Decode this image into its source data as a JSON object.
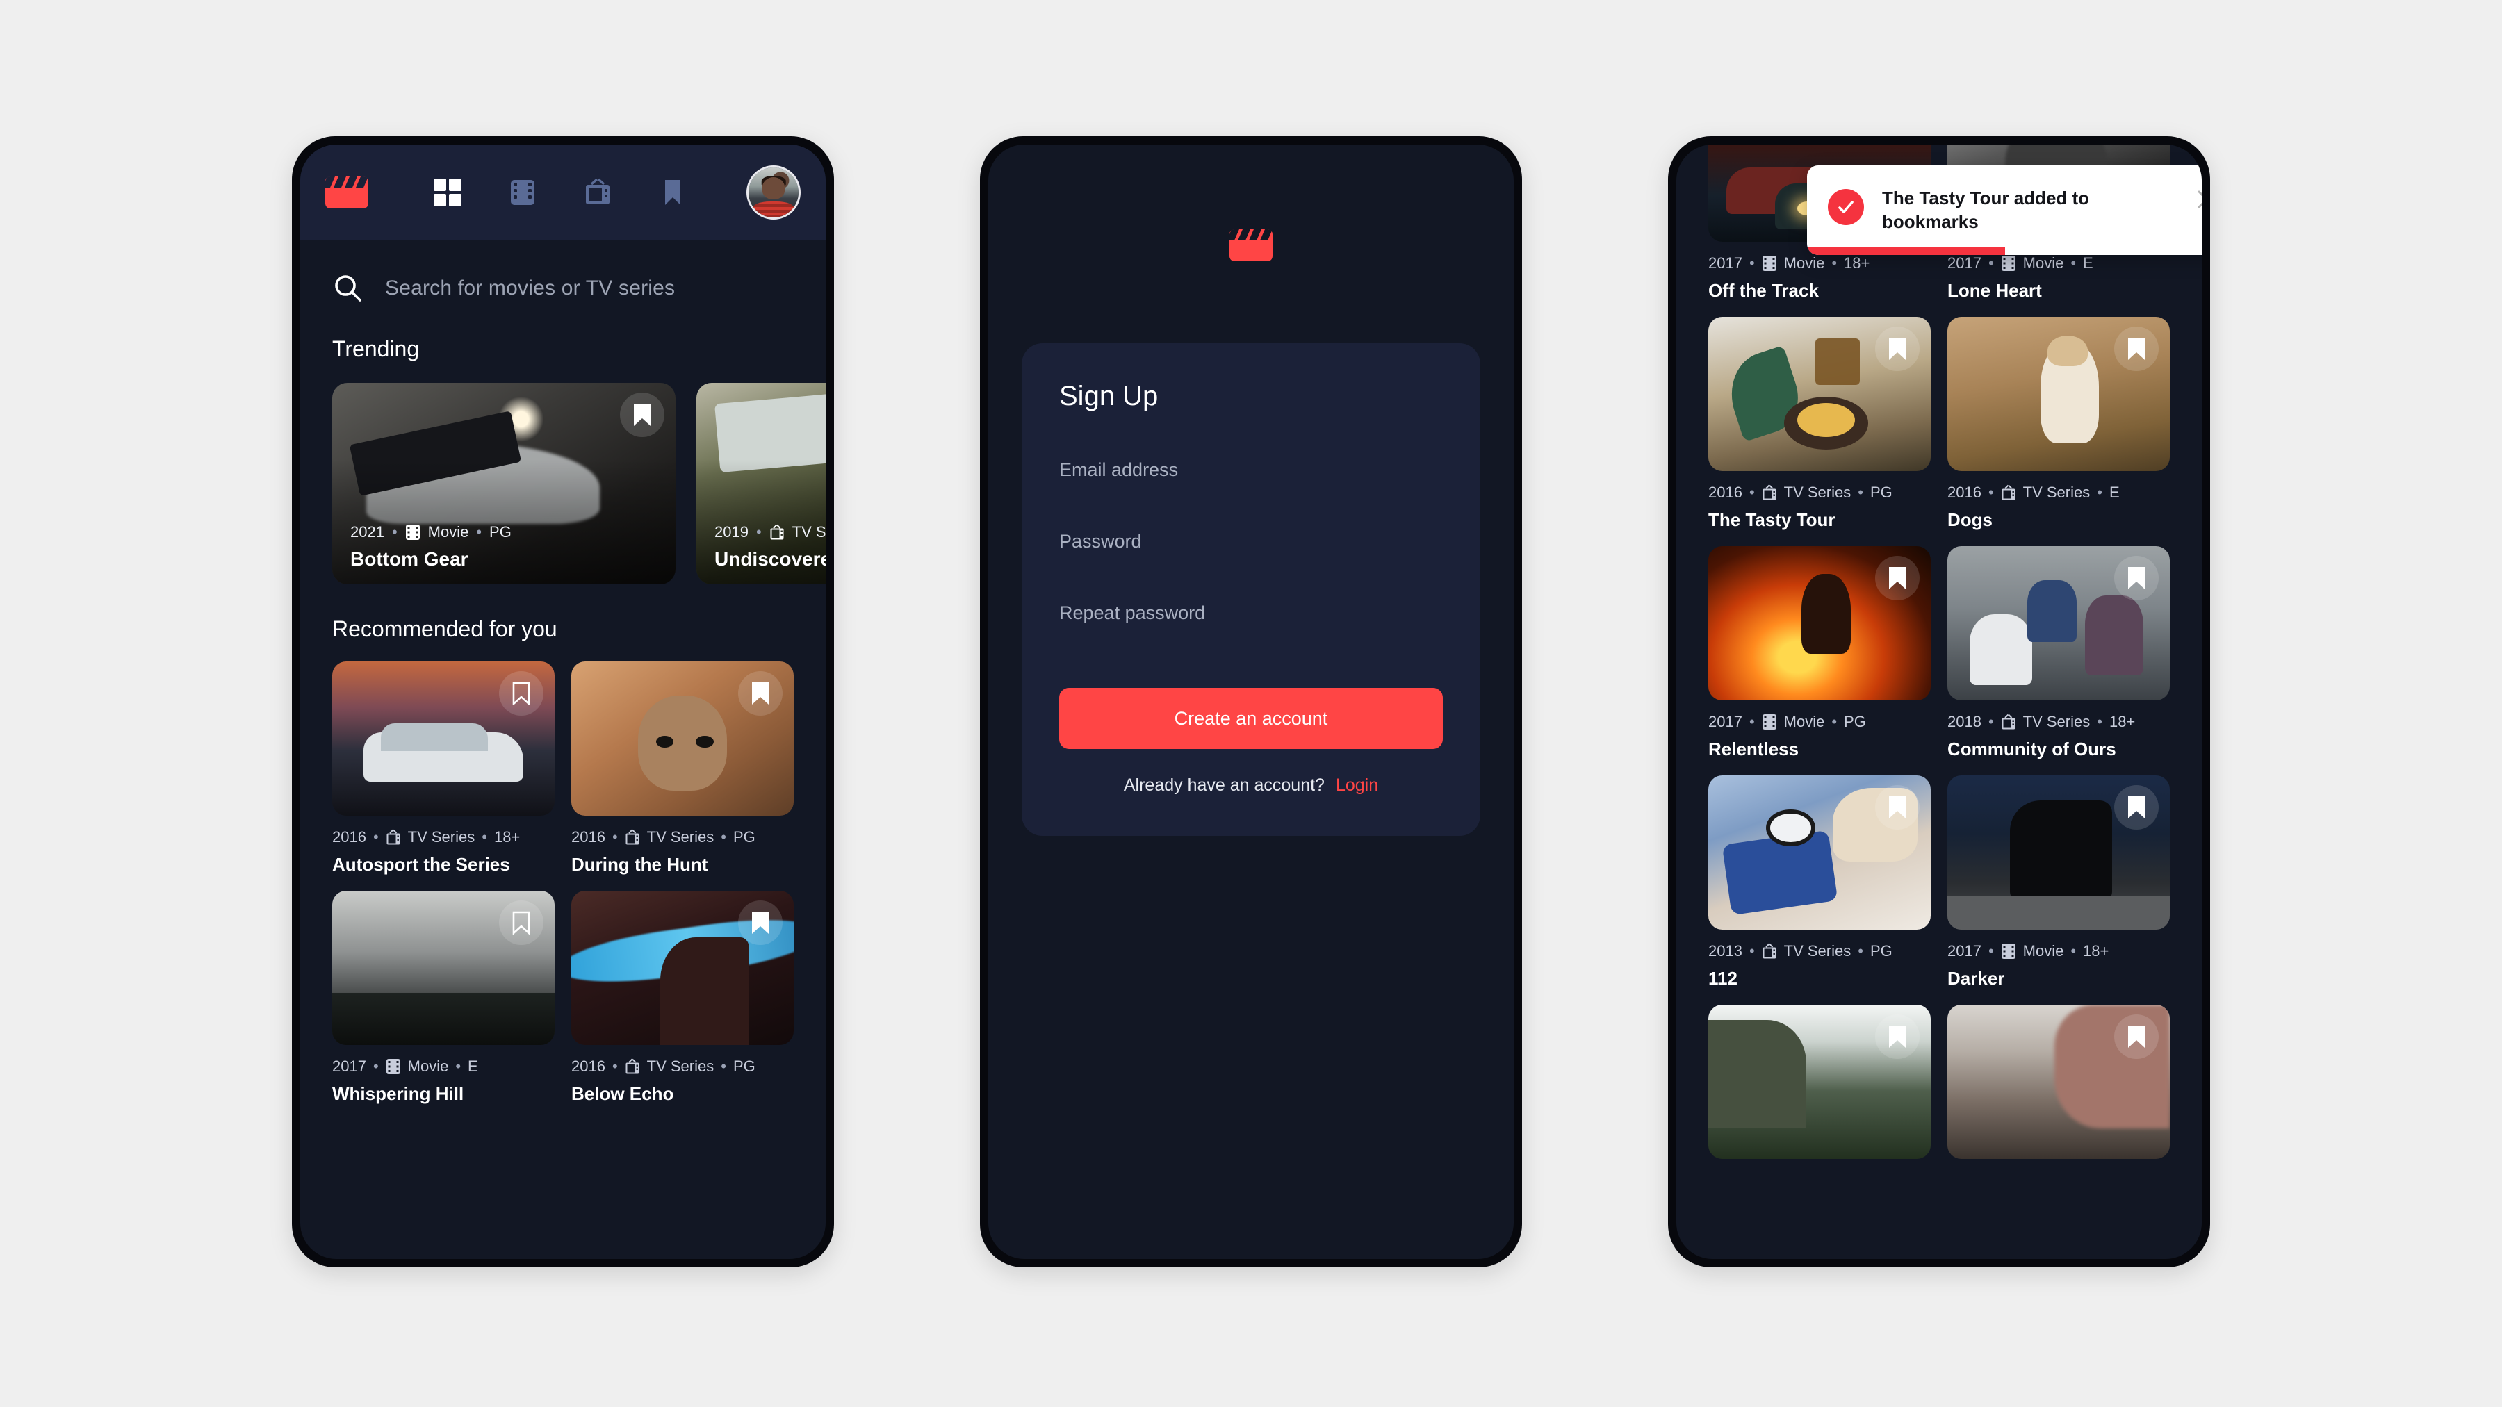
{
  "theme": {
    "accent": "#ff4545",
    "page_bg": "#efefef",
    "screen_bg": "#121724",
    "panel_bg": "#1b2138",
    "muted_icon": "#5a6b96"
  },
  "phone1": {
    "nav": {
      "logo_icon": "clapperboard-logo-icon",
      "items": [
        {
          "icon": "grid-icon",
          "label": "Browse",
          "active": true
        },
        {
          "icon": "film-strip-icon",
          "label": "Movies",
          "active": false
        },
        {
          "icon": "tv-icon",
          "label": "TV Series",
          "active": false
        },
        {
          "icon": "bookmark-icon",
          "label": "Bookmarks",
          "active": false
        }
      ],
      "avatar_icon": "user-avatar"
    },
    "search": {
      "icon": "search-icon",
      "placeholder": "Search for movies or TV series",
      "value": ""
    },
    "trending": {
      "title": "Trending",
      "cards": [
        {
          "year": "2021",
          "type": "Movie",
          "type_icon": "film-strip-icon",
          "rating": "PG",
          "title": "Bottom Gear",
          "bookmarked": true
        },
        {
          "year": "2019",
          "type": "TV Series",
          "type_icon": "tv-icon",
          "rating": "",
          "title": "Undiscovered",
          "bookmarked": false
        }
      ]
    },
    "recommended": {
      "title": "Recommended for you",
      "cards": [
        {
          "year": "2016",
          "type": "TV Series",
          "type_icon": "tv-icon",
          "rating": "18+",
          "title": "Autosport the Series",
          "bookmarked": false
        },
        {
          "year": "2016",
          "type": "TV Series",
          "type_icon": "tv-icon",
          "rating": "PG",
          "title": "During the Hunt",
          "bookmarked": true
        },
        {
          "year": "2017",
          "type": "Movie",
          "type_icon": "film-strip-icon",
          "rating": "E",
          "title": "Whispering Hill",
          "bookmarked": false
        },
        {
          "year": "2016",
          "type": "TV Series",
          "type_icon": "tv-icon",
          "rating": "PG",
          "title": "Below Echo",
          "bookmarked": true
        }
      ]
    }
  },
  "phone2": {
    "logo_icon": "clapperboard-logo-icon",
    "heading": "Sign Up",
    "fields": [
      {
        "name": "email",
        "placeholder": "Email address",
        "value": ""
      },
      {
        "name": "password",
        "placeholder": "Password",
        "value": ""
      },
      {
        "name": "repeat-password",
        "placeholder": "Repeat password",
        "value": ""
      }
    ],
    "submit_label": "Create an account",
    "footer_question": "Already have an account?",
    "footer_link": "Login"
  },
  "phone3": {
    "toast": {
      "icon": "check-circle-icon",
      "message": "The Tasty Tour added to bookmarks",
      "close_icon": "close-icon",
      "progress_percent": 46
    },
    "cards": [
      {
        "year": "2017",
        "type": "Movie",
        "type_icon": "film-strip-icon",
        "rating": "18+",
        "title": "Off the Track",
        "bookmarked": false
      },
      {
        "year": "2017",
        "type": "Movie",
        "type_icon": "film-strip-icon",
        "rating": "E",
        "title": "Lone Heart",
        "bookmarked": false
      },
      {
        "year": "2016",
        "type": "TV Series",
        "type_icon": "tv-icon",
        "rating": "PG",
        "title": "The Tasty Tour",
        "bookmarked": true
      },
      {
        "year": "2016",
        "type": "TV Series",
        "type_icon": "tv-icon",
        "rating": "E",
        "title": "Dogs",
        "bookmarked": true
      },
      {
        "year": "2017",
        "type": "Movie",
        "type_icon": "film-strip-icon",
        "rating": "PG",
        "title": "Relentless",
        "bookmarked": true
      },
      {
        "year": "2018",
        "type": "TV Series",
        "type_icon": "tv-icon",
        "rating": "18+",
        "title": "Community of Ours",
        "bookmarked": true
      },
      {
        "year": "2013",
        "type": "TV Series",
        "type_icon": "tv-icon",
        "rating": "PG",
        "title": "112",
        "bookmarked": true
      },
      {
        "year": "2017",
        "type": "Movie",
        "type_icon": "film-strip-icon",
        "rating": "18+",
        "title": "Darker",
        "bookmarked": true
      }
    ]
  }
}
